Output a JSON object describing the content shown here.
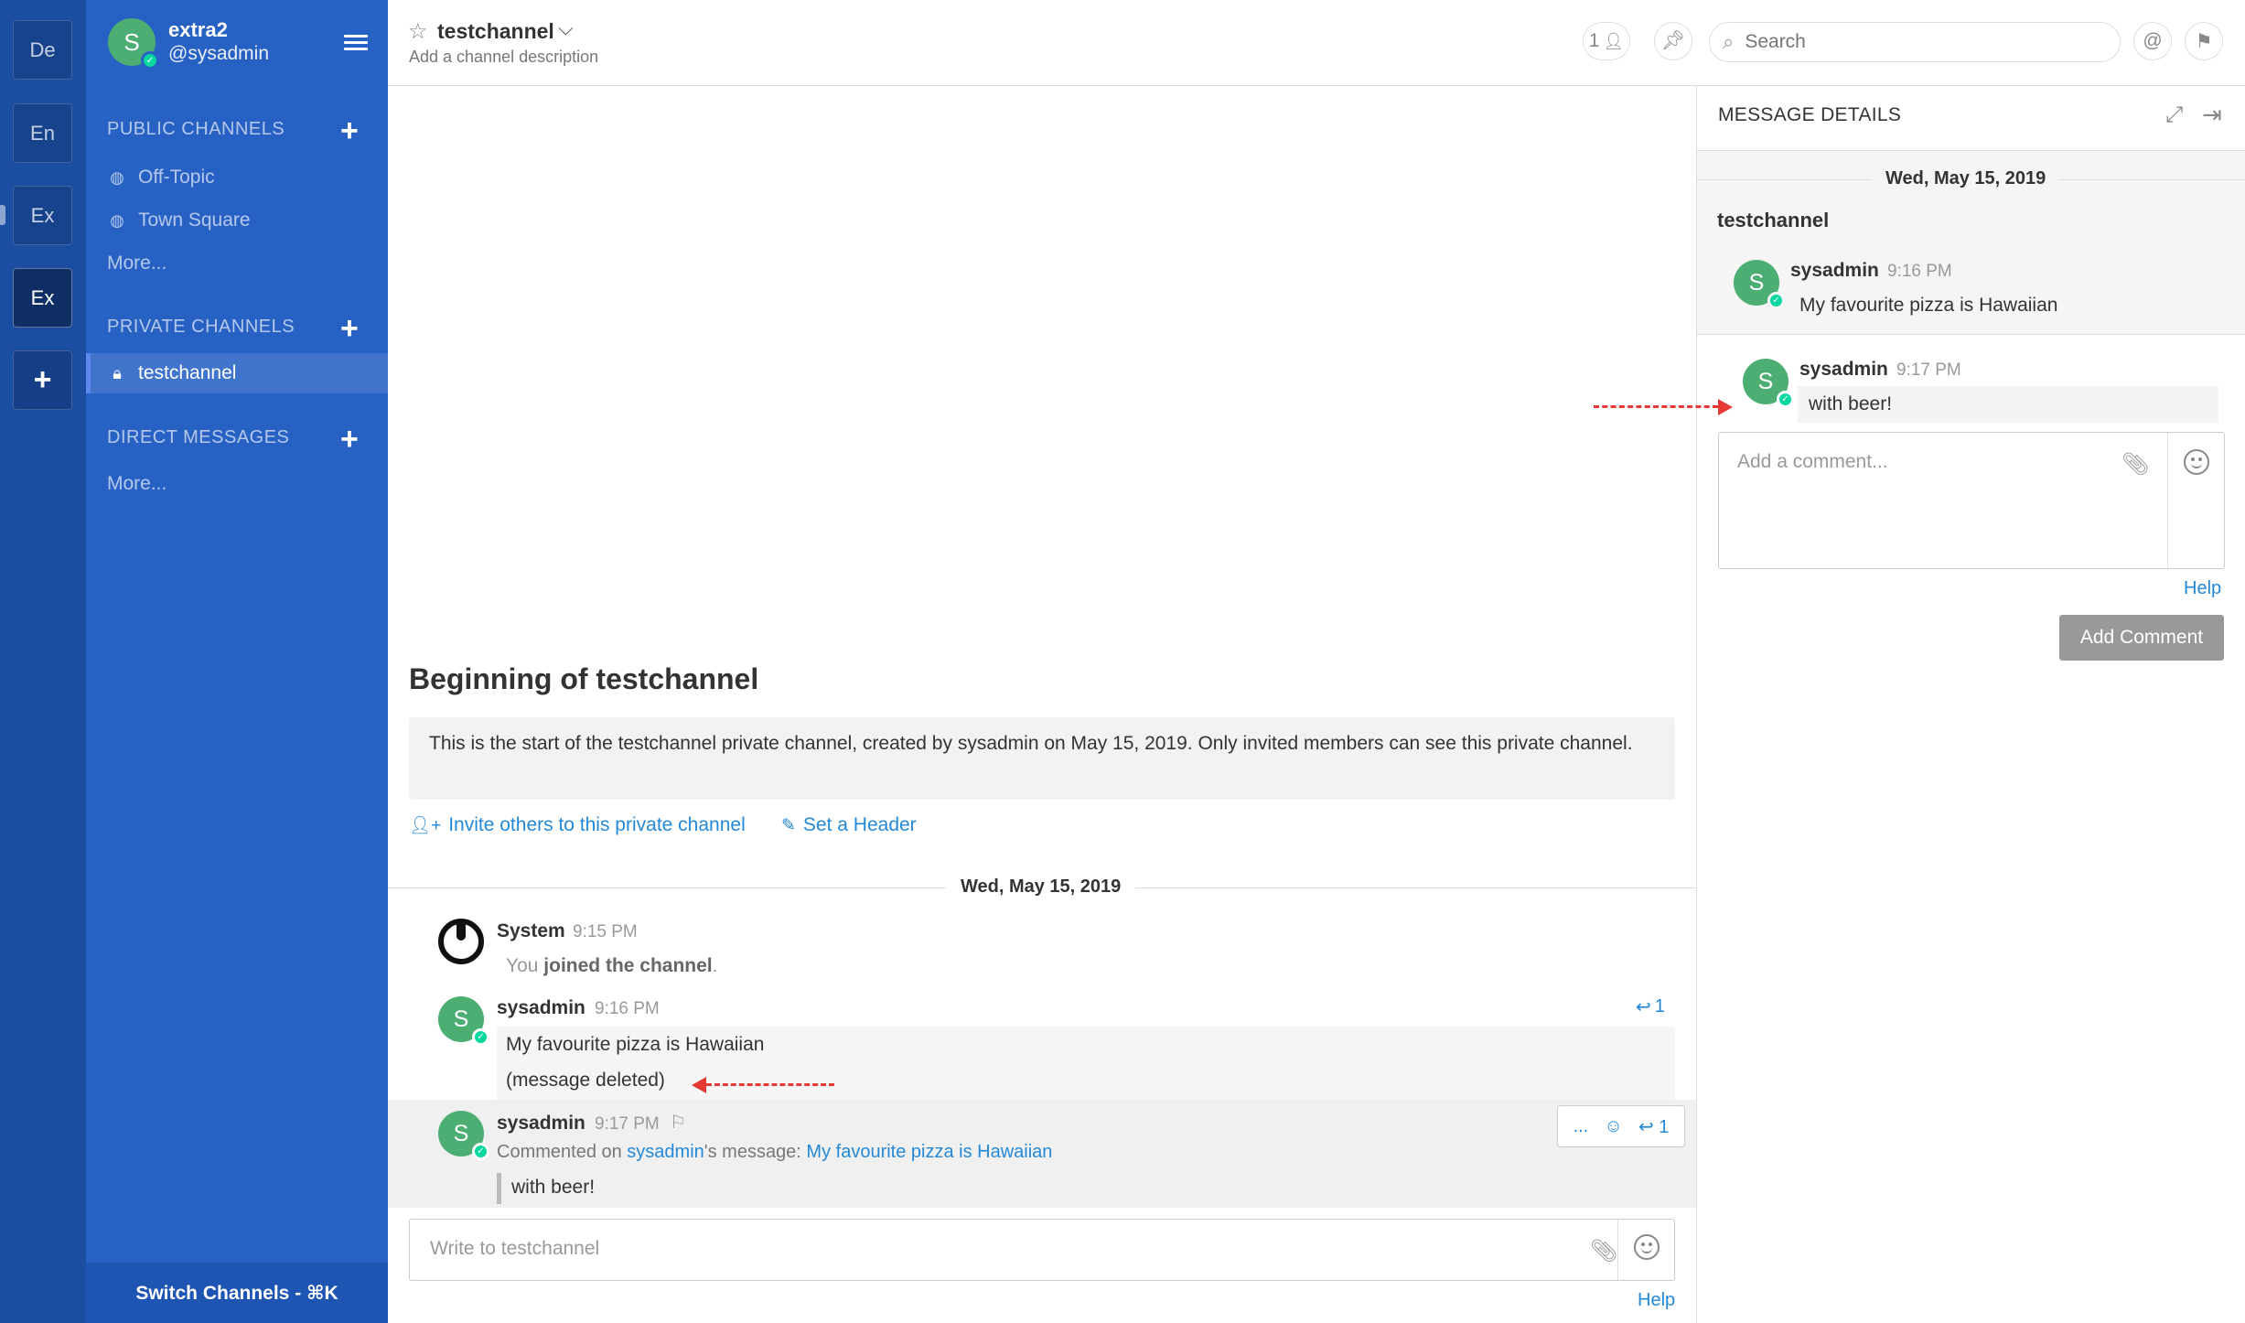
{
  "teams": [
    {
      "label": "De"
    },
    {
      "label": "En"
    },
    {
      "label": "Ex"
    },
    {
      "label": "Ex"
    }
  ],
  "team_add_label": "+",
  "sidebar": {
    "avatar_initial": "S",
    "team_name": "extra2",
    "username": "@sysadmin",
    "public_title": "PUBLIC CHANNELS",
    "public_items": [
      {
        "label": "Off-Topic"
      },
      {
        "label": "Town Square"
      }
    ],
    "public_more": "More...",
    "private_title": "PRIVATE CHANNELS",
    "private_items": [
      {
        "label": "testchannel"
      }
    ],
    "dm_title": "DIRECT MESSAGES",
    "dm_more": "More...",
    "switch_channels": "Switch Channels - ⌘K"
  },
  "header": {
    "channel_name": "testchannel",
    "description": "Add a channel description",
    "member_count": "1",
    "search_placeholder": "Search"
  },
  "center": {
    "intro_title": "Beginning of testchannel",
    "intro_text": "This is the start of the testchannel private channel, created by sysadmin on May 15, 2019. Only invited members can see this private channel.",
    "invite_link": "Invite others to this private channel",
    "header_link": "Set a Header",
    "date": "Wed, May 15, 2019",
    "posts": [
      {
        "user": "System",
        "time": "9:15 PM",
        "text_prefix": "You ",
        "text_bold": "joined the channel",
        "text_suffix": "."
      },
      {
        "user": "sysadmin",
        "time": "9:16 PM",
        "text": "My favourite pizza is Hawaiian",
        "text2": "(message deleted)",
        "reply_count": "1",
        "avatar_initial": "S"
      },
      {
        "user": "sysadmin",
        "time": "9:17 PM",
        "commented_on": "Commented on ",
        "commented_user": "sysadmin",
        "commented_mid": "'s message: ",
        "commented_msg": "My favourite pizza is Hawaiian",
        "text": "with beer!",
        "reply_count": "1",
        "avatar_initial": "S",
        "actions_dots": "..."
      }
    ],
    "input_placeholder": "Write to testchannel",
    "help": "Help"
  },
  "rhs": {
    "title": "MESSAGE DETAILS",
    "date": "Wed, May 15, 2019",
    "channel": "testchannel",
    "root": {
      "user": "sysadmin",
      "time": "9:16 PM",
      "text": "My favourite pizza is Hawaiian",
      "avatar_initial": "S"
    },
    "reply": {
      "user": "sysadmin",
      "time": "9:17 PM",
      "text": "with beer!",
      "avatar_initial": "S"
    },
    "comment_placeholder": "Add a comment...",
    "help": "Help",
    "add_comment": "Add Comment"
  },
  "colors": {
    "team_bar": "#1b4da0",
    "sidebar": "#2761c4",
    "link": "#2389d7",
    "avatar": "#4cae72",
    "annotation": "#e53935"
  }
}
